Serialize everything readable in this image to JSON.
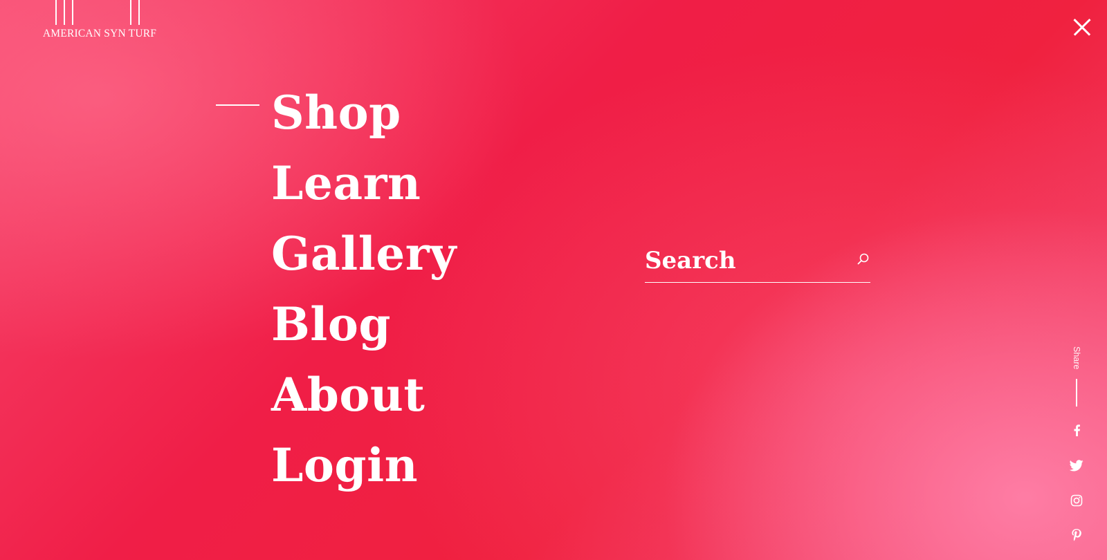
{
  "brand": {
    "logo_text": "AMERICAN SYN TURF"
  },
  "close": {
    "icon": "close-icon"
  },
  "nav": {
    "active_index": 0,
    "items": [
      {
        "label": "Shop"
      },
      {
        "label": "Learn"
      },
      {
        "label": "Gallery"
      },
      {
        "label": "Blog"
      },
      {
        "label": "About"
      },
      {
        "label": "Login"
      }
    ]
  },
  "search": {
    "placeholder": "Search",
    "value": "",
    "icon": "search-icon"
  },
  "share": {
    "label": "Share",
    "links": [
      {
        "icon": "facebook-icon"
      },
      {
        "icon": "twitter-icon"
      },
      {
        "icon": "instagram-icon"
      },
      {
        "icon": "pinterest-icon"
      }
    ]
  },
  "colors": {
    "background_primary": "#f01e47",
    "background_highlight": "#ff82aa",
    "foreground": "#ffffff"
  }
}
